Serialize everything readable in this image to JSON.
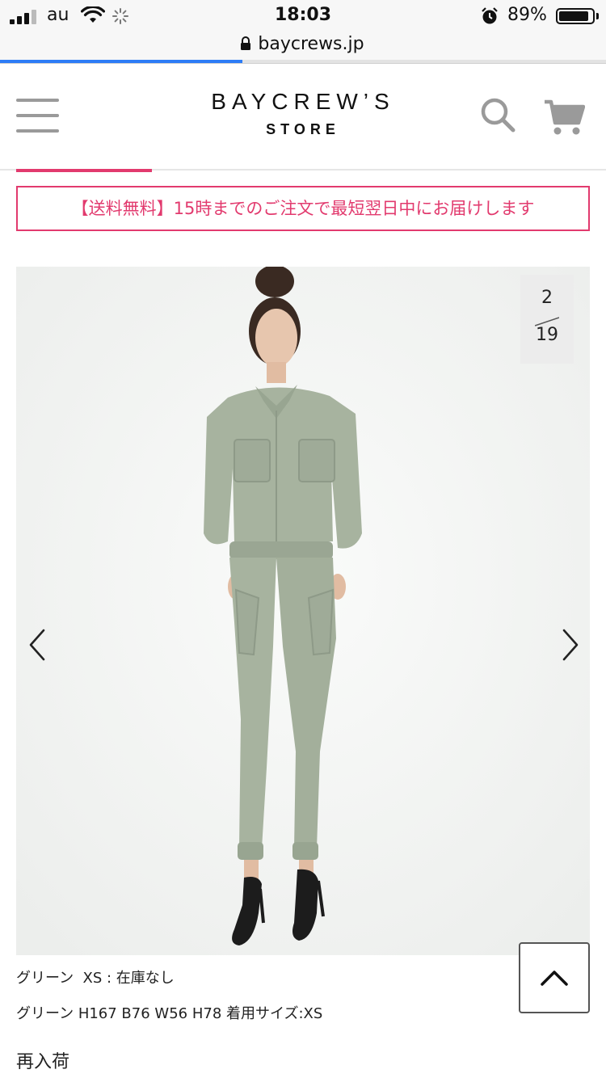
{
  "status_bar": {
    "carrier": "au",
    "time": "18:03",
    "battery_percent": "89%",
    "battery_level": 0.89
  },
  "browser": {
    "url": "baycrews.jp",
    "load_progress": 0.4
  },
  "header": {
    "logo_main": "BAYCREW’S",
    "logo_sub": "STORE",
    "accent_color": "#e23a6e"
  },
  "notice": {
    "text": "【送料無料】15時までのご注文で最短翌日中にお届けします"
  },
  "gallery": {
    "current": "2",
    "total": "19",
    "icons": {
      "prev": "chevron-left-icon",
      "next": "chevron-right-icon"
    }
  },
  "product": {
    "stock_line": "グリーン  XS : 在庫なし",
    "model_line": "グリーン H167 B76 W56 H78 着用サイズ:XS",
    "restock_label": "再入荷"
  },
  "icons": {
    "menu": "hamburger-icon",
    "search": "search-icon",
    "cart": "cart-icon",
    "back_to_top": "chevron-up-icon"
  }
}
